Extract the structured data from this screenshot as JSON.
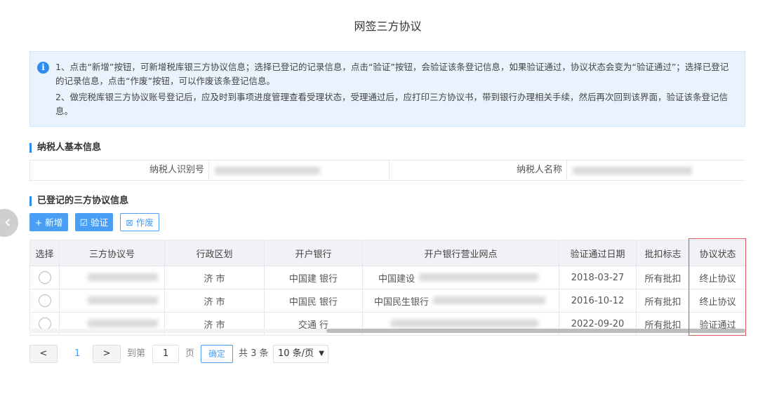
{
  "page_title": "网签三方协议",
  "notice": {
    "line1": "1、点击“新增”按钮，可新增税库银三方协议信息；选择已登记的记录信息，点击“验证”按钮，会验证该条登记信息，如果验证通过，协议状态会变为“验证通过”；选择已登记的记录信息，点击“作废”按钮，可以作废该条登记信息。",
    "line2": "2、做完税库银三方协议账号登记后，应及时到事项进度管理查看受理状态，受理通过后，应打印三方协议书，带到银行办理相关手续，然后再次回到该界面，验证该条登记信息。"
  },
  "taxpayer_section": {
    "heading": "纳税人基本信息",
    "id_label": "纳税人识别号",
    "name_label": "纳税人名称"
  },
  "agreements_section": {
    "heading": "已登记的三方协议信息"
  },
  "toolbar": {
    "add_label": "+ 新增",
    "verify_label": "☑ 验证",
    "void_label": "⊠ 作废"
  },
  "table": {
    "headers": [
      "选择",
      "三方协议号",
      "行政区划",
      "开户银行",
      "开户银行营业网点",
      "验证通过日期",
      "批扣标志",
      "协议状态"
    ],
    "rows": [
      {
        "region": "济   市",
        "bank": "中国建   银行",
        "branch": "中国建设",
        "date": "2018-03-27",
        "flag": "所有批扣",
        "status": "终止协议"
      },
      {
        "region": "济   市",
        "bank": "中国民   银行",
        "branch": "中国民生银行",
        "date": "2016-10-12",
        "flag": "所有批扣",
        "status": "终止协议"
      },
      {
        "region": "济   市",
        "bank": "交通   行",
        "branch": "",
        "date": "2022-09-20",
        "flag": "所有批扣",
        "status": "验证通过"
      }
    ]
  },
  "pagination": {
    "prev_icon": "chevron-left-icon",
    "current_page": "1",
    "next_icon": "chevron-right-icon",
    "goto_label": "到第",
    "page_input": "1",
    "page_suffix": "页",
    "confirm_label": "确定",
    "total_label": "共 3 条",
    "page_size": "10 条/页"
  },
  "colors": {
    "accent": "#4a9ff5",
    "highlight_border": "#e05555"
  }
}
